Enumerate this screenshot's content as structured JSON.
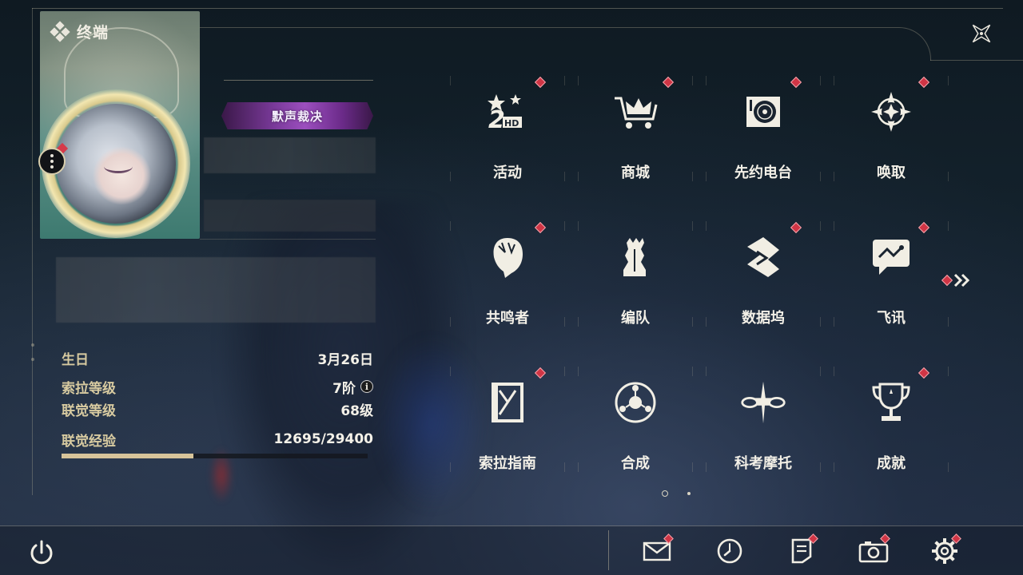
{
  "header": {
    "title": "终端",
    "close_icon": "close-x-icon"
  },
  "profile": {
    "title_badge": "默声裁决",
    "avatar_icon": "avatar-portrait",
    "menu_icon": "more-dots-icon"
  },
  "stats": {
    "birthday_label": "生日",
    "birthday_value": "3月26日",
    "sola_level_label": "索拉等级",
    "sola_level_value": "7阶",
    "union_level_label": "联觉等级",
    "union_level_value": "68级",
    "exp_label": "联觉经验",
    "exp_value": "12695/29400",
    "exp_fraction": 0.4318
  },
  "menu": [
    {
      "label": "活动",
      "icon": "events-icon",
      "badge": true
    },
    {
      "label": "商城",
      "icon": "shop-crown-cart-icon",
      "badge": true
    },
    {
      "label": "先约电台",
      "icon": "radio-turntable-icon",
      "badge": true
    },
    {
      "label": "唤取",
      "icon": "convene-compass-icon",
      "badge": true
    },
    {
      "label": "共鸣者",
      "icon": "resonator-head-icon",
      "badge": true
    },
    {
      "label": "编队",
      "icon": "team-chess-icon",
      "badge": false
    },
    {
      "label": "数据坞",
      "icon": "data-bank-icon",
      "badge": true
    },
    {
      "label": "飞讯",
      "icon": "message-chat-icon",
      "badge": true
    },
    {
      "label": "索拉指南",
      "icon": "guide-book-icon",
      "badge": true
    },
    {
      "label": "合成",
      "icon": "synthesis-icon",
      "badge": false
    },
    {
      "label": "科考摩托",
      "icon": "motorcycle-icon",
      "badge": false
    },
    {
      "label": "成就",
      "icon": "trophy-icon",
      "badge": true
    }
  ],
  "bottom_bar": {
    "power_icon": "power-icon",
    "buttons": [
      {
        "icon": "mail-icon",
        "badge": true
      },
      {
        "icon": "clock-icon",
        "badge": false
      },
      {
        "icon": "notice-document-icon",
        "badge": true
      },
      {
        "icon": "camera-icon",
        "badge": true
      },
      {
        "icon": "settings-gear-icon",
        "badge": true
      }
    ]
  },
  "colors": {
    "accent_gold": "#d7c49a",
    "badge_red": "#d03545"
  },
  "pager": {
    "pages": 2,
    "current": 1
  }
}
